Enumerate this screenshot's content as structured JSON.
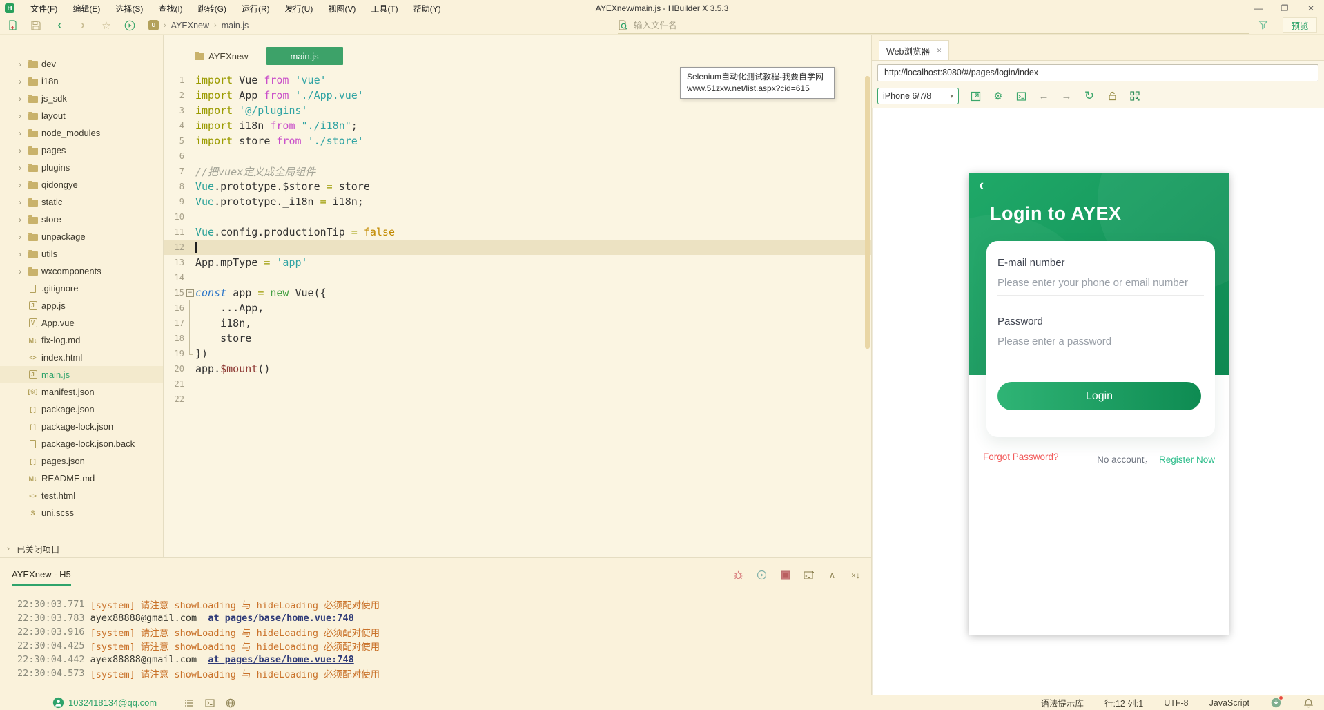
{
  "app": {
    "title": "AYEXnew/main.js - HBuilder X 3.5.3",
    "preview_label": "预览"
  },
  "menus": [
    "文件(F)",
    "编辑(E)",
    "选择(S)",
    "查找(I)",
    "跳转(G)",
    "运行(R)",
    "发行(U)",
    "视图(V)",
    "工具(T)",
    "帮助(Y)"
  ],
  "toolbar": {
    "breadcrumb": [
      "AYEXnew",
      "main.js"
    ],
    "search_placeholder": "输入文件名"
  },
  "icons": {
    "logo": "H-square",
    "new-file-icon": "page-plus",
    "save-icon": "floppy",
    "back-icon": "chevron-left",
    "forward-icon": "chevron-right",
    "star-icon": "star-outline",
    "run-icon": "play-circle",
    "filter-icon": "funnel",
    "file-search-icon": "magnifier-page",
    "gear-icon": "⚙",
    "refresh-icon": "↻",
    "bug-icon": "bug",
    "stop-icon": "■",
    "collapse-icon": "∧",
    "clear-icon": "×↓",
    "bell-icon": "bell",
    "qr-icon": "qr-grid",
    "lock-icon": "padlock",
    "console-icon": ">_",
    "user-icon": "person-circle"
  },
  "sidebar": {
    "folders": [
      "dev",
      "i18n",
      "js_sdk",
      "layout",
      "node_modules",
      "pages",
      "plugins",
      "qidongye",
      "static",
      "store",
      "unpackage",
      "utils",
      "wxcomponents"
    ],
    "files": [
      {
        "name": ".gitignore",
        "icon": "plain-file-icon"
      },
      {
        "name": "app.js",
        "icon": "js-file-icon"
      },
      {
        "name": "App.vue",
        "icon": "vue-file-icon"
      },
      {
        "name": "fix-log.md",
        "icon": "markdown-file-icon"
      },
      {
        "name": "index.html",
        "icon": "html-file-icon"
      },
      {
        "name": "main.js",
        "icon": "js-file-icon",
        "selected": true
      },
      {
        "name": "manifest.json",
        "icon": "manifest-file-icon"
      },
      {
        "name": "package.json",
        "icon": "json-file-icon"
      },
      {
        "name": "package-lock.json",
        "icon": "json-file-icon"
      },
      {
        "name": "package-lock.json.back",
        "icon": "plain-file-icon"
      },
      {
        "name": "pages.json",
        "icon": "json-file-icon"
      },
      {
        "name": "README.md",
        "icon": "markdown-file-icon"
      },
      {
        "name": "test.html",
        "icon": "html-file-icon"
      },
      {
        "name": "uni.scss",
        "icon": "scss-file-icon"
      }
    ],
    "closed_projects": "已关闭项目"
  },
  "editor": {
    "project_tab": "AYEXnew",
    "file_tab": "main.js",
    "cursor_line": 12,
    "lines": [
      {
        "n": 1,
        "seg": [
          [
            "import ",
            "kw"
          ],
          [
            "Vue ",
            "id"
          ],
          [
            "from ",
            "from"
          ],
          [
            "'vue'",
            "str"
          ]
        ]
      },
      {
        "n": 2,
        "seg": [
          [
            "import ",
            "kw"
          ],
          [
            "App ",
            "id"
          ],
          [
            "from ",
            "from"
          ],
          [
            "'./App.vue'",
            "str"
          ]
        ]
      },
      {
        "n": 3,
        "seg": [
          [
            "import ",
            "kw"
          ],
          [
            "'@/plugins'",
            "str"
          ]
        ]
      },
      {
        "n": 4,
        "seg": [
          [
            "import ",
            "kw"
          ],
          [
            "i18n ",
            "id"
          ],
          [
            "from ",
            "from"
          ],
          [
            "\"./i18n\"",
            "str"
          ],
          [
            ";",
            "id"
          ]
        ]
      },
      {
        "n": 5,
        "seg": [
          [
            "import ",
            "kw"
          ],
          [
            "store ",
            "id"
          ],
          [
            "from ",
            "from"
          ],
          [
            "'./store'",
            "str"
          ]
        ]
      },
      {
        "n": 6,
        "seg": []
      },
      {
        "n": 7,
        "seg": [
          [
            "//把vuex定义成全局组件",
            "comment"
          ]
        ]
      },
      {
        "n": 8,
        "seg": [
          [
            "Vue",
            "type"
          ],
          [
            ".prototype.$store ",
            "id"
          ],
          [
            "= ",
            "op"
          ],
          [
            "store",
            "id"
          ]
        ]
      },
      {
        "n": 9,
        "seg": [
          [
            "Vue",
            "type"
          ],
          [
            ".prototype._i18n ",
            "id"
          ],
          [
            "= ",
            "op"
          ],
          [
            "i18n;",
            "id"
          ]
        ]
      },
      {
        "n": 10,
        "seg": []
      },
      {
        "n": 11,
        "seg": [
          [
            "Vue",
            "type"
          ],
          [
            ".config.productionTip ",
            "id"
          ],
          [
            "= ",
            "op"
          ],
          [
            "false",
            "bool"
          ]
        ]
      },
      {
        "n": 12,
        "seg": [],
        "cursor": true
      },
      {
        "n": 13,
        "seg": [
          [
            "App.mpType ",
            "id"
          ],
          [
            "= ",
            "op"
          ],
          [
            "'app'",
            "str"
          ]
        ]
      },
      {
        "n": 14,
        "seg": []
      },
      {
        "n": 15,
        "seg": [
          [
            "const ",
            "const"
          ],
          [
            "app ",
            "id"
          ],
          [
            "= ",
            "op"
          ],
          [
            "new ",
            "new"
          ],
          [
            "Vue({",
            "id"
          ]
        ],
        "fold": "open"
      },
      {
        "n": 16,
        "seg": [
          [
            "    ...App,",
            "id"
          ]
        ],
        "fold": "bar"
      },
      {
        "n": 17,
        "seg": [
          [
            "    i18n,",
            "id"
          ]
        ],
        "fold": "bar"
      },
      {
        "n": 18,
        "seg": [
          [
            "    store",
            "id"
          ]
        ],
        "fold": "bar"
      },
      {
        "n": 19,
        "seg": [
          [
            "})",
            "id"
          ]
        ],
        "fold": "end"
      },
      {
        "n": 20,
        "seg": [
          [
            "app.",
            "id"
          ],
          [
            "$mount",
            "mount"
          ],
          [
            "()",
            "id"
          ]
        ]
      },
      {
        "n": 21,
        "seg": []
      },
      {
        "n": 22,
        "seg": []
      }
    ]
  },
  "tooltip": {
    "line1": "Selenium自动化测试教程-我要自学网",
    "line2": "www.51zxw.net/list.aspx?cid=615"
  },
  "browser": {
    "tab_label": "Web浏览器",
    "close_label": "×",
    "url": "http://localhost:8080/#/pages/login/index",
    "device": "iPhone 6/7/8"
  },
  "login": {
    "back_glyph": "‹",
    "title": "Login to AYEX",
    "email_label": "E-mail number",
    "email_placeholder": "Please enter your phone or email number",
    "password_label": "Password",
    "password_placeholder": "Please enter a password",
    "button": "Login",
    "forgot": "Forgot Password?",
    "no_account": "No account，",
    "register": "Register Now"
  },
  "console": {
    "title": "AYEXnew - H5",
    "logs": [
      {
        "time": "22:30:03.771 ",
        "parts": [
          [
            "[system] 请注意 showLoading 与 hideLoading 必须配对使用",
            "sys"
          ]
        ]
      },
      {
        "time": "22:30:03.783 ",
        "parts": [
          [
            "ayex88888@gmail.com",
            "plain"
          ],
          [
            "  ",
            "plain"
          ],
          [
            "at pages/base/home.vue:748",
            "link"
          ]
        ]
      },
      {
        "time": "22:30:03.916 ",
        "parts": [
          [
            "[system] 请注意 showLoading 与 hideLoading 必须配对使用",
            "sys"
          ]
        ]
      },
      {
        "time": "22:30:04.425 ",
        "parts": [
          [
            "[system] 请注意 showLoading 与 hideLoading 必须配对使用",
            "sys"
          ]
        ]
      },
      {
        "time": "22:30:04.442 ",
        "parts": [
          [
            "ayex88888@gmail.com",
            "plain"
          ],
          [
            "  ",
            "plain"
          ],
          [
            "at pages/base/home.vue:748",
            "link"
          ]
        ]
      },
      {
        "time": "22:30:04.573 ",
        "parts": [
          [
            "[system] 请注意 showLoading 与 hideLoading 必须配对使用",
            "sys"
          ]
        ]
      }
    ]
  },
  "statusbar": {
    "account": "1032418134@qq.com",
    "syntax_lib": "语法提示库",
    "cursor_pos": "行:12  列:1",
    "encoding": "UTF-8",
    "language": "JavaScript"
  },
  "colors": {
    "accent_green": "#2FA36B",
    "active_tab_green": "#3DA269",
    "log_orange": "#C9722A",
    "forgot_red": "#F15B5B",
    "register_teal": "#2FBE8C"
  }
}
